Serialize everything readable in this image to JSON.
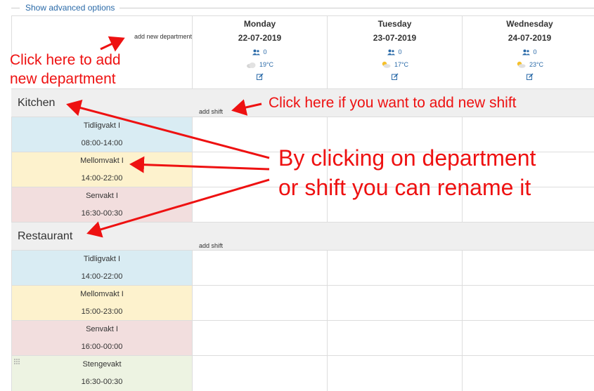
{
  "advanced": {
    "label": "Show advanced options"
  },
  "header": {
    "add_department": "add new department"
  },
  "days": [
    {
      "name": "Monday",
      "date": "22-07-2019",
      "staff": "0",
      "temp": "19°C",
      "weather_icon": "cloud-icon"
    },
    {
      "name": "Tuesday",
      "date": "23-07-2019",
      "staff": "0",
      "temp": "17°C",
      "weather_icon": "partly-sunny-icon"
    },
    {
      "name": "Wednesday",
      "date": "24-07-2019",
      "staff": "0",
      "temp": "23°C",
      "weather_icon": "partly-sunny-icon"
    }
  ],
  "departments": [
    {
      "name": "Kitchen",
      "add_shift": "add shift",
      "shifts": [
        {
          "name": "Tidligvakt I",
          "time": "08:00-14:00",
          "color": "#d9ecf3"
        },
        {
          "name": "Mellomvakt I",
          "time": "14:00-22:00",
          "color": "#fdf2cd"
        },
        {
          "name": "Senvakt I",
          "time": "16:30-00:30",
          "color": "#f2dede"
        }
      ]
    },
    {
      "name": "Restaurant",
      "add_shift": "add shift",
      "shifts": [
        {
          "name": "Tidligvakt I",
          "time": "14:00-22:00",
          "color": "#d9ecf3"
        },
        {
          "name": "Mellomvakt I",
          "time": "15:00-23:00",
          "color": "#fdf2cd"
        },
        {
          "name": "Senvakt I",
          "time": "16:00-00:00",
          "color": "#f2dede"
        },
        {
          "name": "Stengevakt",
          "time": "16:30-00:30",
          "color": "#edf3e2"
        }
      ]
    }
  ],
  "annotations": {
    "add_department_1": "Click here to add",
    "add_department_2": "new department",
    "add_shift": "Click here if you want to add new shift",
    "rename_1": "By clicking on department",
    "rename_2": "or shift you can rename it"
  },
  "colors": {
    "annotation": "#ee1111",
    "link": "#2a6aa8"
  }
}
